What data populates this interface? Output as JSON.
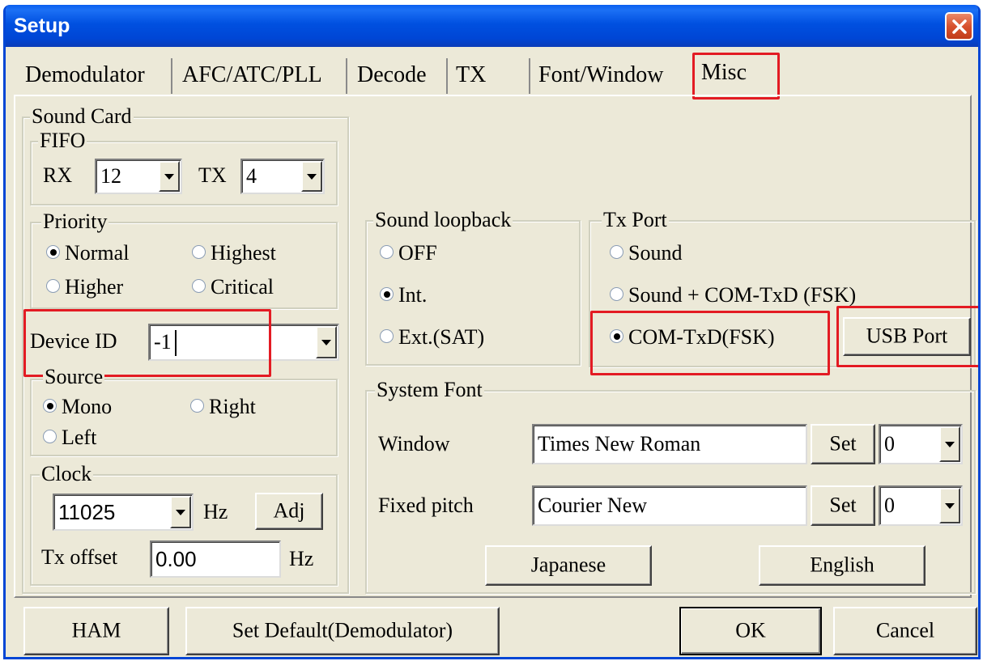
{
  "window": {
    "title": "Setup"
  },
  "tabs": [
    "Demodulator",
    "AFC/ATC/PLL",
    "Decode",
    "TX",
    "Font/Window",
    "Misc"
  ],
  "sound_card": {
    "title": "Sound Card",
    "fifo": {
      "title": "FIFO",
      "rx_label": "RX",
      "rx_value": "12",
      "tx_label": "TX",
      "tx_value": "4"
    },
    "priority": {
      "title": "Priority",
      "options": [
        "Normal",
        "Highest",
        "Higher",
        "Critical"
      ],
      "selected": "Normal"
    },
    "device_id": {
      "label": "Device ID",
      "value": "-1"
    },
    "source": {
      "title": "Source",
      "options": [
        "Mono",
        "Right",
        "Left"
      ],
      "selected": "Mono"
    },
    "clock": {
      "title": "Clock",
      "value": "11025",
      "unit": "Hz",
      "adj_label": "Adj",
      "tx_offset_label": "Tx offset",
      "tx_offset_value": "0.00",
      "tx_offset_unit": "Hz"
    }
  },
  "sound_loopback": {
    "title": "Sound loopback",
    "options": [
      "OFF",
      "Int.",
      "Ext.(SAT)"
    ],
    "selected": "Int."
  },
  "tx_port": {
    "title": "Tx Port",
    "options": [
      "Sound",
      "Sound + COM-TxD (FSK)",
      "COM-TxD(FSK)"
    ],
    "selected": "COM-TxD(FSK)",
    "usb_port_label": "USB Port"
  },
  "system_font": {
    "title": "System Font",
    "window_label": "Window",
    "window_font": "Times New Roman",
    "window_charset": "0",
    "fixed_label": "Fixed pitch",
    "fixed_font": "Courier New",
    "fixed_charset": "0",
    "set_label": "Set",
    "japanese_label": "Japanese",
    "english_label": "English"
  },
  "footer": {
    "ham_label": "HAM",
    "set_default_label": "Set Default(Demodulator)",
    "ok_label": "OK",
    "cancel_label": "Cancel"
  },
  "colors": {
    "titlebar": "#0046d5",
    "dialog_bg": "#ece9d8",
    "highlight": "#e31b23"
  }
}
